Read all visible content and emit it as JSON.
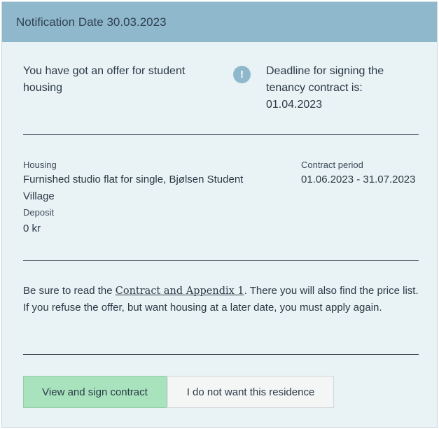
{
  "header": {
    "notification_date": "Notification Date 30.03.2023"
  },
  "offer": {
    "message": "You have got an offer for student housing",
    "info_icon": "info-icon",
    "info_glyph": "!",
    "deadline_text": "Deadline for signing the tenancy contract is:",
    "deadline_date": "01.04.2023"
  },
  "details": {
    "housing_label": "Housing",
    "housing_value": "Furnished studio flat for single, Bjølsen Student Village",
    "deposit_label": "Deposit",
    "deposit_value": "0 kr",
    "contract_period_label": "Contract period",
    "contract_period_value": "01.06.2023 - 31.07.2023"
  },
  "notice": {
    "before_link": "Be sure to read the ",
    "link_text": "Contract and Appendix 1",
    "after_link": ". There you will also find the price list. If you refuse the offer, but want housing at a later date, you must apply again."
  },
  "actions": {
    "sign_label": "View and sign contract",
    "decline_label": "I do not want this residence"
  },
  "colors": {
    "header_bg": "#8fb8cc",
    "card_bg": "#e9f2f5",
    "primary_button": "#a8e3bd",
    "secondary_button": "#f4f5f5"
  }
}
